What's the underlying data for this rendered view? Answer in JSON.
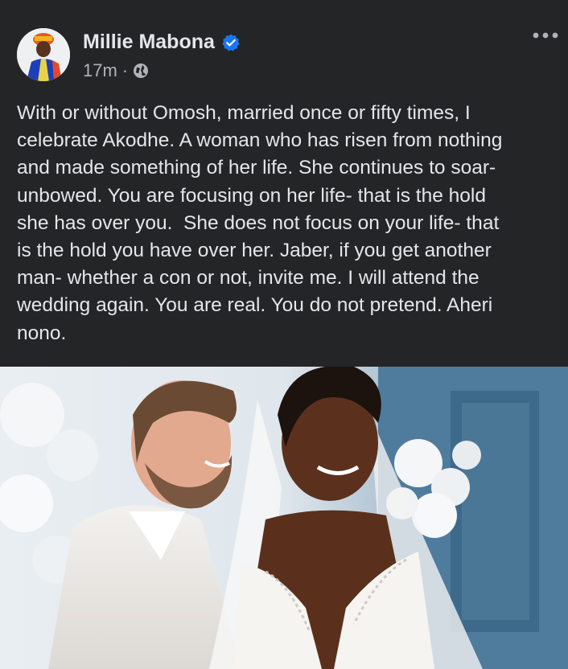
{
  "post": {
    "author_name": "Millie Mabona",
    "timestamp": "17m",
    "separator": "·",
    "text": "With or without Omosh, married once or fifty times, I\ncelebrate Akodhe. A woman who has risen from nothing\nand made something of her life. She continues to soar-\nunbowed. You are focusing on her life- that is the hold\nshe has over you.  She does not focus on your life- that\nis the hold you have over her. Jaber, if you get another\nman- whether a con or not, invite me. I will attend the\nwedding again. You are real. You do not pretend. Aheri\nnono."
  },
  "icons": {
    "verified": "verified-badge-icon",
    "audience": "globe-icon",
    "more": "more-options-icon"
  },
  "colors": {
    "background": "#242526",
    "text_primary": "#e4e6eb",
    "text_secondary": "#b0b3b8",
    "verified_blue": "#1877f2"
  }
}
